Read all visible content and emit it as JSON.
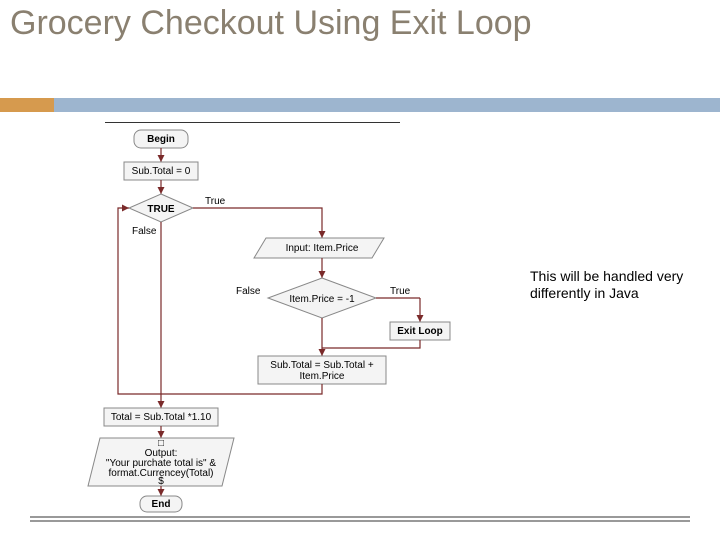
{
  "title": "Grocery Checkout Using Exit Loop",
  "note": "This will be handled very differently in Java",
  "nodes": {
    "begin": "Begin",
    "init": "Sub.Total = 0",
    "cond_true": "TRUE",
    "input": "Input: Item.Price",
    "decision": "Item.Price = -1",
    "exit": "Exit Loop",
    "accum": "Sub.Total = Sub.Total + Item.Price",
    "total": "Total = Sub.Total *1.10",
    "output": "Output: \"Your purchate total is\" & format.Currencey(Total) $",
    "end": "End"
  },
  "labels": {
    "cond_out_true": "True",
    "cond_out_false": "False",
    "dec_true": "True",
    "dec_false": "False"
  }
}
